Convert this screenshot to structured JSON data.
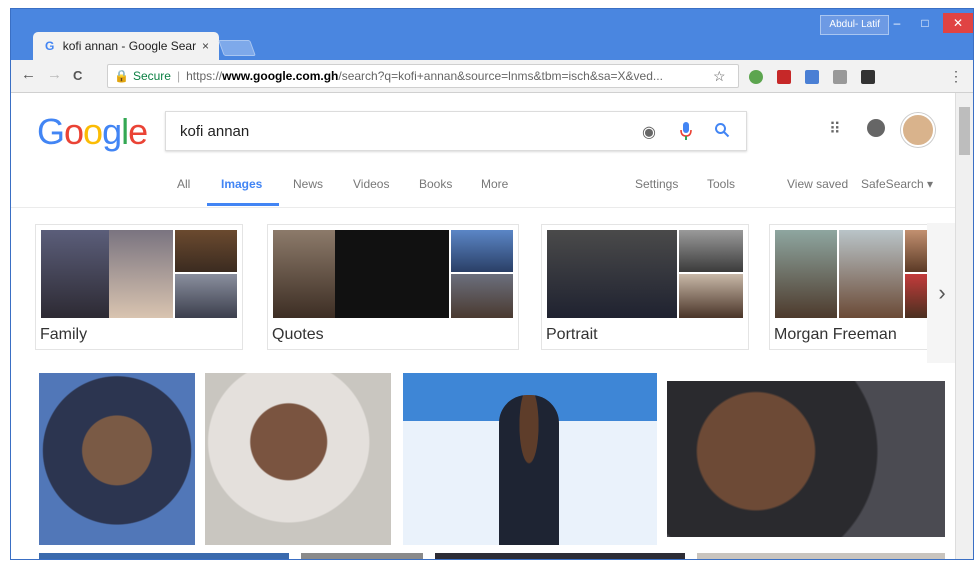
{
  "browser": {
    "tab_title": "kofi annan - Google Sear",
    "tab_favicon": "G",
    "tab_close": "×",
    "user_name": "Abdul- Latif",
    "min": "‒",
    "max": "□",
    "close": "✕",
    "back": "←",
    "forward": "→",
    "reload": "C",
    "secure_label": "Secure",
    "url_prefix": "https://",
    "url_host": "www.google.com.gh",
    "url_rest": "/search?q=kofi+annan&source=lnms&tbm=isch&sa=X&ved...",
    "star": "☆",
    "menu": "⋮"
  },
  "google": {
    "logo_letters": [
      {
        "ch": "G",
        "color": "#4285f4"
      },
      {
        "ch": "o",
        "color": "#ea4335"
      },
      {
        "ch": "o",
        "color": "#fbbc05"
      },
      {
        "ch": "g",
        "color": "#4285f4"
      },
      {
        "ch": "l",
        "color": "#34a853"
      },
      {
        "ch": "e",
        "color": "#ea4335"
      }
    ],
    "query": "kofi annan",
    "camera_icon": "◉",
    "mic_icon": "🎤",
    "search_icon": "🔍",
    "apps_icon": "⠿"
  },
  "search_tabs": {
    "all": "All",
    "images": "Images",
    "news": "News",
    "videos": "Videos",
    "books": "Books",
    "more": "More",
    "settings": "Settings",
    "tools": "Tools",
    "view_saved": "View saved",
    "safesearch": "SafeSearch ▾"
  },
  "related": [
    {
      "label": "Family"
    },
    {
      "label": "Quotes"
    },
    {
      "label": "Portrait"
    },
    {
      "label": "Morgan Freeman"
    }
  ],
  "more_arrow": "›",
  "colors": {
    "accent": "#4285f4",
    "frame": "#4a86e0",
    "secure": "#0b8043"
  }
}
